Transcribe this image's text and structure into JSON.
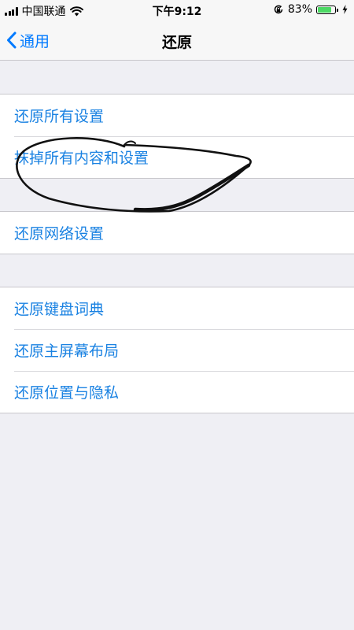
{
  "status_bar": {
    "carrier": "中国联通",
    "time": "下午9:12",
    "battery_percent": "83%",
    "battery_level": 0.83
  },
  "nav": {
    "back_label": "通用",
    "title": "还原"
  },
  "groups": [
    {
      "items": [
        "还原所有设置",
        "抹掉所有内容和设置"
      ]
    },
    {
      "items": [
        "还原网络设置"
      ]
    },
    {
      "items": [
        "还原键盘词典",
        "还原主屏幕布局",
        "还原位置与隐私"
      ]
    }
  ],
  "colors": {
    "accent": "#007aff",
    "cell_text": "#1a82e2",
    "battery_fill": "#4cd964",
    "background": "#efeff4"
  }
}
